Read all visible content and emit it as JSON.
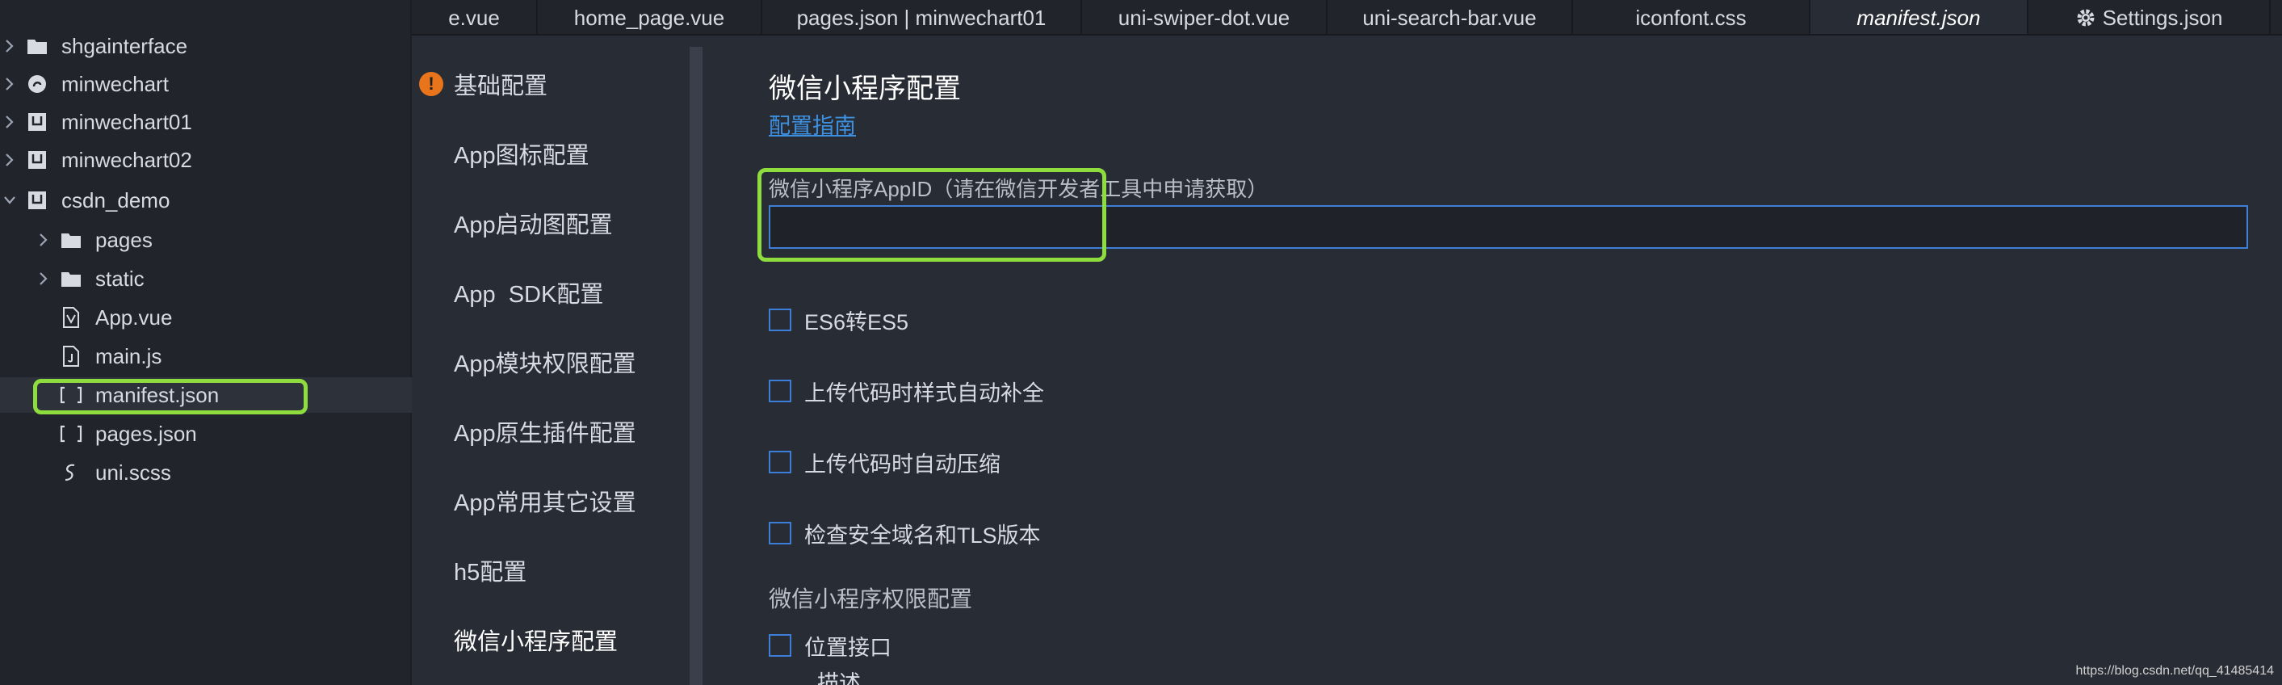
{
  "colors": {
    "accent_highlight": "#8fdc3f",
    "link": "#3d8fe0",
    "warning": "#e8741b",
    "checkbox_border": "#3d7fd8"
  },
  "file_tree": [
    {
      "label": "shgainterface",
      "icon": "folder-icon",
      "expanded": false
    },
    {
      "label": "minwechart",
      "icon": "link-project-icon",
      "expanded": false
    },
    {
      "label": "minwechart01",
      "icon": "project-icon",
      "expanded": false
    },
    {
      "label": "minwechart02",
      "icon": "project-icon",
      "expanded": false
    },
    {
      "label": "csdn_demo",
      "icon": "project-icon",
      "expanded": true
    },
    {
      "label": "pages",
      "icon": "folder-icon",
      "expanded": false
    },
    {
      "label": "static",
      "icon": "folder-icon",
      "expanded": false
    },
    {
      "label": "App.vue",
      "icon": "vue-file-icon"
    },
    {
      "label": "main.js",
      "icon": "js-file-icon"
    },
    {
      "label": "manifest.json",
      "icon": "json-file-icon",
      "selected": true
    },
    {
      "label": "pages.json",
      "icon": "json-file-icon"
    },
    {
      "label": "uni.scss",
      "icon": "scss-file-icon"
    }
  ],
  "tabs": [
    {
      "label": "e.vue"
    },
    {
      "label": "home_page.vue"
    },
    {
      "label": "pages.json | minwechart01"
    },
    {
      "label": "uni-swiper-dot.vue"
    },
    {
      "label": "uni-search-bar.vue"
    },
    {
      "label": "iconfont.css"
    },
    {
      "label": "manifest.json",
      "active": true
    },
    {
      "label": "Settings.json",
      "icon": "gear-icon"
    }
  ],
  "settings_nav": [
    {
      "label": "基础配置",
      "warning": true
    },
    {
      "label": "App图标配置"
    },
    {
      "label": "App启动图配置"
    },
    {
      "label": "App  SDK配置"
    },
    {
      "label": "App模块权限配置"
    },
    {
      "label": "App原生插件配置"
    },
    {
      "label": "App常用其它设置"
    },
    {
      "label": "h5配置"
    },
    {
      "label": "微信小程序配置",
      "active": true
    }
  ],
  "main": {
    "title": "微信小程序配置",
    "guide_link": "配置指南",
    "appid_label": "微信小程序AppID（请在微信开发者工具中申请获取）",
    "appid_value": "",
    "options": [
      {
        "label": "ES6转ES5",
        "checked": false
      },
      {
        "label": "上传代码时样式自动补全",
        "checked": false
      },
      {
        "label": "上传代码时自动压缩",
        "checked": false
      },
      {
        "label": "检查安全域名和TLS版本",
        "checked": false
      }
    ],
    "permission_title": "微信小程序权限配置",
    "permission_item": {
      "label": "位置接口",
      "checked": false
    },
    "permission_desc": "描述"
  },
  "watermark": "https://blog.csdn.net/qq_41485414"
}
